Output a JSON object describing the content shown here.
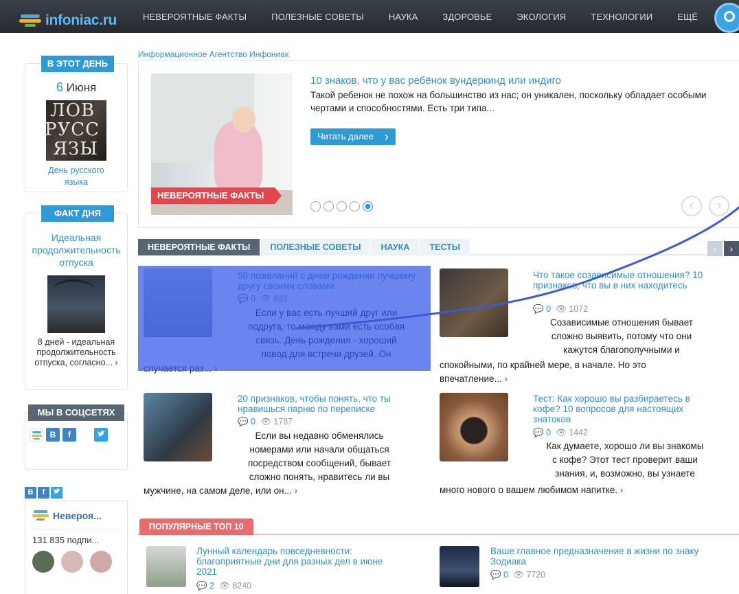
{
  "header": {
    "logo_text": "infoniac.ru",
    "nav": [
      "НЕВЕРОЯТНЫЕ ФАКТЫ",
      "ПОЛЕЗНЫЕ СОВЕТЫ",
      "НАУКА",
      "ЗДОРОВЬЕ",
      "ЭКОЛОГИЯ",
      "ТЕХНОЛОГИИ",
      "ЕЩЁ"
    ],
    "search_icon": "search-icon"
  },
  "sidebar": {
    "on_this_day": {
      "heading": "В ЭТОТ ДЕНЬ",
      "day": "6",
      "month": "Июня",
      "image_text": [
        "ЛОВ",
        "РУСС",
        "ЯЗЫ"
      ],
      "link": "День русского языка"
    },
    "fact_of_day": {
      "heading": "ФАКТ ДНЯ",
      "title": "Идеальная продолжительность отпуска",
      "text": "8 дней - идеальная продолжительность отпуска, согласно...",
      "more_arrow": "›"
    },
    "social": {
      "heading": "МЫ В СОЦСЕТЯХ",
      "icons": [
        "В",
        "f"
      ]
    },
    "vk_widget": {
      "tabs": [
        "B",
        "f"
      ],
      "group_name": "Невероя...",
      "subscribers": "131 835 подпи..."
    }
  },
  "main": {
    "agency": "Информационное Агентство Инфониак",
    "feature": {
      "tag": "НЕВЕРОЯТНЫЕ ФАКТЫ",
      "title": "10 знаков, что у вас ребёнок вундеркинд или индиго",
      "text": "Такой ребенок не похож на большинство из нас; он уникален, поскольку обладает особыми чертами и способностями. Есть три типа...",
      "button": "Читать далее",
      "dots": 5,
      "active_dot": 5,
      "prev": "‹",
      "next": "›"
    },
    "tabs": [
      "НЕВЕРОЯТНЫЕ ФАКТЫ",
      "ПОЛЕЗНЫЕ СОВЕТЫ",
      "НАУКА",
      "ТЕСТЫ"
    ],
    "tab_arrows": [
      "‹",
      "›"
    ],
    "articles": [
      {
        "title": "50 пожеланий с днем рождения лучшему другу своими словами",
        "comments": "0",
        "views": "631",
        "text_lines": [
          "Если у вас есть лучший друг или",
          "подруга, то между вами есть особая",
          "связь. День рождения - хороший",
          "повод для встречи друзей. Он"
        ],
        "tail": "случается раз..."
      },
      {
        "title": "Что такое созависимые отношения? 10 признаков, что вы в них находитесь",
        "comments": "0",
        "views": "1072",
        "text_lines": [
          "Созависимые отношения бывает",
          "сложно выявить, потому что они",
          "кажутся благополучными и"
        ],
        "tail": "спокойными, по крайней мере, в начале. Но это впечатление..."
      },
      {
        "title": "20 признаков, чтобы понять, что ты нравишься парню по переписке",
        "comments": "0",
        "views": "1787",
        "text_lines": [
          "Если вы недавно обменялись",
          "номерами или начали общаться",
          "посредством сообщений, бывает",
          "сложно понять, нравитесь ли вы"
        ],
        "tail": "мужчине, на самом деле, или он..."
      },
      {
        "title": "Тест: Как хорошо вы разбираетесь в кофе? 10 вопросов для настоящих знатоков",
        "comments": "0",
        "views": "1442",
        "text_lines": [
          "Как думаете, хорошо ли вы знакомы",
          "с кофе? Этот тест проверит ваши",
          "знания, и, возможно, вы узнаете"
        ],
        "tail": "много нового о вашем любимом напитке."
      }
    ],
    "popular": {
      "tag": "ПОПУЛЯРНЫЕ ТОП 10",
      "items": [
        {
          "title": "Лунный календарь повседневности: благоприятные дни для разных дел в июне 2021",
          "comments": "2",
          "views": "8240"
        },
        {
          "title": "Ваше главное предназначение в жизни по знаку Зодиака",
          "comments": "0",
          "views": "7720"
        }
      ]
    }
  },
  "colors": {
    "accent": "#2e9ad8",
    "link": "#2e8fd0",
    "tag_red": "#e5464b",
    "nav_bg": "#2b3036",
    "highlight": "#3056e8"
  }
}
